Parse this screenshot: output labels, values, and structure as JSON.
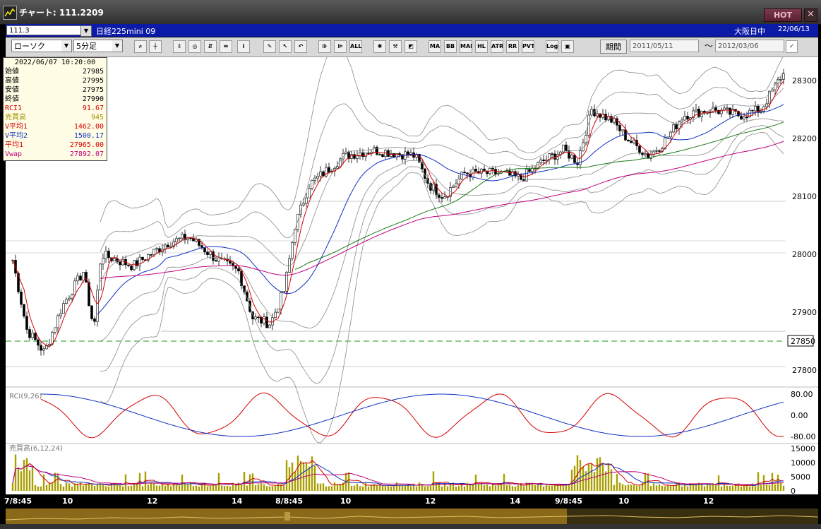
{
  "window": {
    "title": "チャート: 111.2209",
    "hot_label": "HOT",
    "close_label": "✕"
  },
  "infobar": {
    "code": "111.3",
    "symbol": "日経225mini 09",
    "exchange": "大阪日中",
    "date": "22/06/13"
  },
  "toolbar": {
    "chart_type": "ローソク",
    "interval": "5分足",
    "period_label": "期間",
    "date_from": "2011/05/11",
    "date_to": "2012/03/06",
    "tilde": "～",
    "buttons": [
      "MA",
      "BB",
      "MAE",
      "HL",
      "ATR",
      "RR",
      "PVT",
      "Log",
      "ALL"
    ]
  },
  "info_panel": {
    "datetime": "2022/06/07  10:20:00",
    "rows": [
      {
        "label": "始値",
        "value": "27985",
        "color": "#000000"
      },
      {
        "label": "高値",
        "value": "27995",
        "color": "#000000"
      },
      {
        "label": "安値",
        "value": "27975",
        "color": "#000000"
      },
      {
        "label": "終値",
        "value": "27990",
        "color": "#000000"
      },
      {
        "label": "RCI1",
        "value": "91.67",
        "color": "#d40000"
      },
      {
        "label": "売買高",
        "value": "945",
        "color": "#a09000"
      },
      {
        "label": "V平均1",
        "value": "1462.00",
        "color": "#d40000"
      },
      {
        "label": "V平均2",
        "value": "1500.17",
        "color": "#1030c0"
      },
      {
        "label": "平均1",
        "value": "27965.00",
        "color": "#d40000"
      },
      {
        "label": "Vwap",
        "value": "27892.07",
        "color": "#c0007a"
      }
    ]
  },
  "main_chart": {
    "y_ticks": [
      "28300",
      "28200",
      "28100",
      "28000",
      "27900",
      "27800"
    ],
    "current_price": "27850"
  },
  "rci_panel": {
    "label": "RCI(9,26)",
    "y_ticks": [
      "80.00",
      "0.00",
      "-80.00"
    ]
  },
  "volume_panel": {
    "label": "売買高(6,12,24)",
    "y_ticks": [
      "15000",
      "10000",
      "5000",
      "0"
    ]
  },
  "x_axis": {
    "labels": [
      "7/8:45",
      "10",
      "12",
      "14",
      "8/8:45",
      "10",
      "12",
      "14",
      "9/8:45",
      "10",
      "12"
    ]
  },
  "colors": {
    "ma_short": "#d40000",
    "ma_mid": "#1030c0",
    "ma_long": "#1a7a1a",
    "vwap": "#c0007a",
    "volume_bar": "#a8a000",
    "band": "#8a8a8a"
  }
}
